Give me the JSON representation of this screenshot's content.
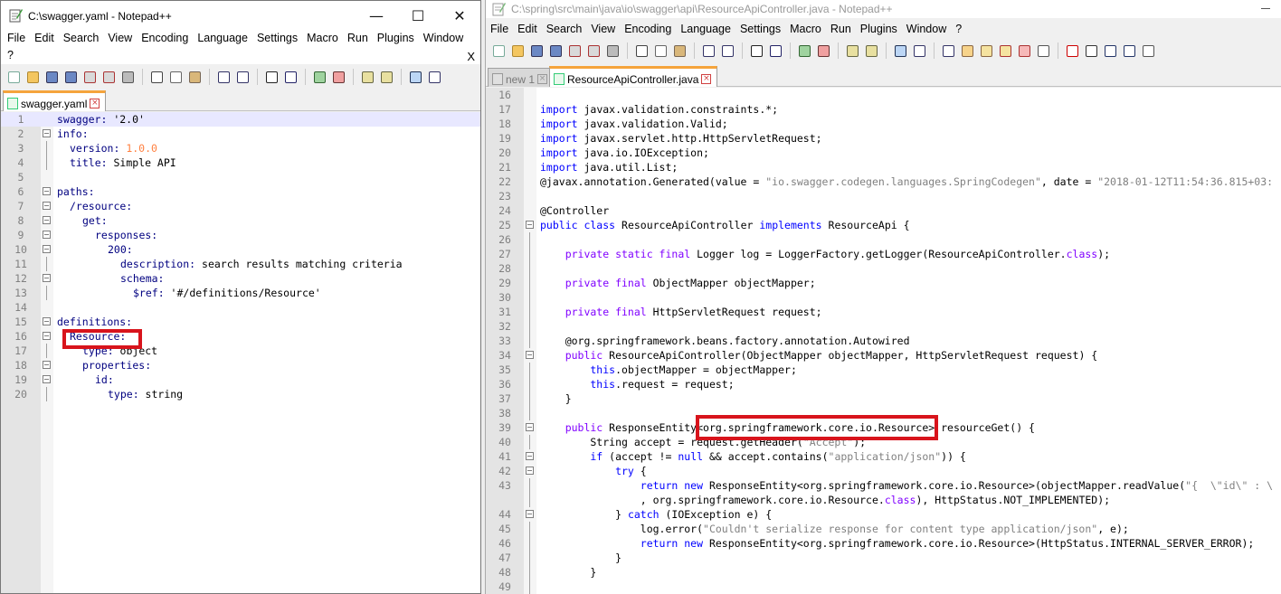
{
  "left_window": {
    "title": "C:\\swagger.yaml - Notepad++",
    "caption": {
      "minimize": "—",
      "maximize": "☐",
      "close": "✕"
    },
    "menu": [
      "File",
      "Edit",
      "Search",
      "View",
      "Encoding",
      "Language",
      "Settings",
      "Macro",
      "Run",
      "Plugins",
      "Window",
      "?"
    ],
    "menu_close": "X",
    "tab": {
      "label": "swagger.yaml",
      "close": "×"
    },
    "lines": [
      {
        "n": "1",
        "fold": "none",
        "indent": 0,
        "segments": [
          {
            "t": "swagger: ",
            "c": "tk-key"
          },
          {
            "t": "'2.0'",
            "c": "tk-str"
          }
        ]
      },
      {
        "n": "2",
        "fold": "box",
        "indent": 0,
        "segments": [
          {
            "t": "info:",
            "c": "tk-key"
          }
        ]
      },
      {
        "n": "3",
        "fold": "line",
        "indent": 2,
        "segments": [
          {
            "t": "version: ",
            "c": "tk-key"
          },
          {
            "t": "1.0.0",
            "c": "tk-num"
          }
        ]
      },
      {
        "n": "4",
        "fold": "line",
        "indent": 2,
        "segments": [
          {
            "t": "title: ",
            "c": "tk-key"
          },
          {
            "t": "Simple API",
            "c": "tk-str"
          }
        ]
      },
      {
        "n": "5",
        "fold": "none",
        "indent": 0,
        "segments": []
      },
      {
        "n": "6",
        "fold": "box",
        "indent": 0,
        "segments": [
          {
            "t": "paths:",
            "c": "tk-key"
          }
        ]
      },
      {
        "n": "7",
        "fold": "box",
        "indent": 2,
        "segments": [
          {
            "t": "/resource:",
            "c": "tk-key"
          }
        ]
      },
      {
        "n": "8",
        "fold": "box",
        "indent": 4,
        "segments": [
          {
            "t": "get:",
            "c": "tk-key"
          }
        ]
      },
      {
        "n": "9",
        "fold": "box",
        "indent": 6,
        "segments": [
          {
            "t": "responses:",
            "c": "tk-key"
          }
        ]
      },
      {
        "n": "10",
        "fold": "box",
        "indent": 8,
        "segments": [
          {
            "t": "200:",
            "c": "tk-key"
          }
        ]
      },
      {
        "n": "11",
        "fold": "line",
        "indent": 10,
        "segments": [
          {
            "t": "description: ",
            "c": "tk-key"
          },
          {
            "t": "search results matching criteria",
            "c": "tk-str"
          }
        ]
      },
      {
        "n": "12",
        "fold": "box",
        "indent": 10,
        "segments": [
          {
            "t": "schema:",
            "c": "tk-key"
          }
        ]
      },
      {
        "n": "13",
        "fold": "line",
        "indent": 12,
        "segments": [
          {
            "t": "$ref: ",
            "c": "tk-key"
          },
          {
            "t": "'#/definitions/Resource'",
            "c": "tk-str"
          }
        ]
      },
      {
        "n": "14",
        "fold": "none",
        "indent": 0,
        "segments": []
      },
      {
        "n": "15",
        "fold": "box",
        "indent": 0,
        "segments": [
          {
            "t": "definitions:",
            "c": "tk-key"
          }
        ]
      },
      {
        "n": "16",
        "fold": "box",
        "indent": 2,
        "segments": [
          {
            "t": "Resource:",
            "c": "tk-key"
          }
        ]
      },
      {
        "n": "17",
        "fold": "line",
        "indent": 4,
        "segments": [
          {
            "t": "type: ",
            "c": "tk-key"
          },
          {
            "t": "object",
            "c": "tk-str"
          }
        ]
      },
      {
        "n": "18",
        "fold": "box",
        "indent": 4,
        "segments": [
          {
            "t": "properties:",
            "c": "tk-key"
          }
        ]
      },
      {
        "n": "19",
        "fold": "box",
        "indent": 6,
        "segments": [
          {
            "t": "id:",
            "c": "tk-key"
          }
        ]
      },
      {
        "n": "20",
        "fold": "line",
        "indent": 8,
        "segments": [
          {
            "t": "type: ",
            "c": "tk-key"
          },
          {
            "t": "string",
            "c": "tk-str"
          }
        ]
      }
    ]
  },
  "right_window": {
    "title": "C:\\spring\\src\\main\\java\\io\\swagger\\api\\ResourceApiController.java - Notepad++",
    "menu": [
      "File",
      "Edit",
      "Search",
      "View",
      "Encoding",
      "Language",
      "Settings",
      "Macro",
      "Run",
      "Plugins",
      "Window",
      "?"
    ],
    "tabs": [
      {
        "label": "new 1",
        "close": "×",
        "active": false
      },
      {
        "label": "ResourceApiController.java",
        "close": "×",
        "active": true
      }
    ],
    "lines": [
      {
        "n": "16",
        "fold": "none",
        "segments": []
      },
      {
        "n": "17",
        "fold": "none",
        "segments": [
          {
            "t": "import ",
            "c": "tk-kw"
          },
          {
            "t": "javax.validation.constraints.*;",
            "c": "tk-ann"
          }
        ]
      },
      {
        "n": "18",
        "fold": "none",
        "segments": [
          {
            "t": "import ",
            "c": "tk-kw"
          },
          {
            "t": "javax.validation.Valid;",
            "c": "tk-ann"
          }
        ]
      },
      {
        "n": "19",
        "fold": "none",
        "segments": [
          {
            "t": "import ",
            "c": "tk-kw"
          },
          {
            "t": "javax.servlet.http.HttpServletRequest;",
            "c": "tk-ann"
          }
        ]
      },
      {
        "n": "20",
        "fold": "none",
        "segments": [
          {
            "t": "import ",
            "c": "tk-kw"
          },
          {
            "t": "java.io.IOException;",
            "c": "tk-ann"
          }
        ]
      },
      {
        "n": "21",
        "fold": "none",
        "segments": [
          {
            "t": "import ",
            "c": "tk-kw"
          },
          {
            "t": "java.util.List;",
            "c": "tk-ann"
          }
        ]
      },
      {
        "n": "22",
        "fold": "none",
        "segments": [
          {
            "t": "@javax.annotation.Generated(value = ",
            "c": "tk-ann"
          },
          {
            "t": "\"io.swagger.codegen.languages.SpringCodegen\"",
            "c": "tk-lit"
          },
          {
            "t": ", date = ",
            "c": "tk-ann"
          },
          {
            "t": "\"2018-01-12T11:54:36.815+03:",
            "c": "tk-lit"
          }
        ]
      },
      {
        "n": "23",
        "fold": "none",
        "segments": []
      },
      {
        "n": "24",
        "fold": "none",
        "segments": [
          {
            "t": "@Controller",
            "c": "tk-ann"
          }
        ]
      },
      {
        "n": "25",
        "fold": "box",
        "segments": [
          {
            "t": "public class ",
            "c": "tk-kw"
          },
          {
            "t": "ResourceApiController ",
            "c": "tk-ann"
          },
          {
            "t": "implements ",
            "c": "tk-kw"
          },
          {
            "t": "ResourceApi {",
            "c": "tk-ann"
          }
        ]
      },
      {
        "n": "26",
        "fold": "line",
        "segments": []
      },
      {
        "n": "27",
        "fold": "line",
        "segments": [
          {
            "t": "    private static final ",
            "c": "tk-kwb"
          },
          {
            "t": "Logger log = LoggerFactory.getLogger(ResourceApiController.",
            "c": "tk-ann"
          },
          {
            "t": "class",
            "c": "tk-kwb"
          },
          {
            "t": ");",
            "c": "tk-ann"
          }
        ]
      },
      {
        "n": "28",
        "fold": "line",
        "segments": []
      },
      {
        "n": "29",
        "fold": "line",
        "segments": [
          {
            "t": "    private final ",
            "c": "tk-kwb"
          },
          {
            "t": "ObjectMapper objectMapper;",
            "c": "tk-ann"
          }
        ]
      },
      {
        "n": "30",
        "fold": "line",
        "segments": []
      },
      {
        "n": "31",
        "fold": "line",
        "segments": [
          {
            "t": "    private final ",
            "c": "tk-kwb"
          },
          {
            "t": "HttpServletRequest request;",
            "c": "tk-ann"
          }
        ]
      },
      {
        "n": "32",
        "fold": "line",
        "segments": []
      },
      {
        "n": "33",
        "fold": "line",
        "segments": [
          {
            "t": "    @org.springframework.beans.factory.annotation.Autowired",
            "c": "tk-ann"
          }
        ]
      },
      {
        "n": "34",
        "fold": "box",
        "segments": [
          {
            "t": "    public ",
            "c": "tk-kwb"
          },
          {
            "t": "ResourceApiController(ObjectMapper objectMapper, HttpServletRequest request) {",
            "c": "tk-ann"
          }
        ]
      },
      {
        "n": "35",
        "fold": "line",
        "segments": [
          {
            "t": "        this",
            "c": "tk-kw"
          },
          {
            "t": ".objectMapper = objectMapper;",
            "c": "tk-ann"
          }
        ]
      },
      {
        "n": "36",
        "fold": "line",
        "segments": [
          {
            "t": "        this",
            "c": "tk-kw"
          },
          {
            "t": ".request = request;",
            "c": "tk-ann"
          }
        ]
      },
      {
        "n": "37",
        "fold": "line",
        "segments": [
          {
            "t": "    }",
            "c": "tk-ann"
          }
        ]
      },
      {
        "n": "38",
        "fold": "line",
        "segments": []
      },
      {
        "n": "39",
        "fold": "box",
        "segments": [
          {
            "t": "    public ",
            "c": "tk-kwb"
          },
          {
            "t": "ResponseEntity<org.springframework.core.io.Resource> resourceGet() {",
            "c": "tk-ann"
          }
        ]
      },
      {
        "n": "40",
        "fold": "line",
        "segments": [
          {
            "t": "        String accept = request.getHeader(",
            "c": "tk-ann"
          },
          {
            "t": "\"Accept\"",
            "c": "tk-lit"
          },
          {
            "t": ");",
            "c": "tk-ann"
          }
        ]
      },
      {
        "n": "41",
        "fold": "box",
        "segments": [
          {
            "t": "        if ",
            "c": "tk-kw"
          },
          {
            "t": "(accept != ",
            "c": "tk-ann"
          },
          {
            "t": "null ",
            "c": "tk-kw"
          },
          {
            "t": "&& accept.contains(",
            "c": "tk-ann"
          },
          {
            "t": "\"application/json\"",
            "c": "tk-lit"
          },
          {
            "t": ")) {",
            "c": "tk-ann"
          }
        ]
      },
      {
        "n": "42",
        "fold": "box",
        "segments": [
          {
            "t": "            try ",
            "c": "tk-kw"
          },
          {
            "t": "{",
            "c": "tk-ann"
          }
        ]
      },
      {
        "n": "43",
        "fold": "line",
        "segments": [
          {
            "t": "                return new ",
            "c": "tk-kw"
          },
          {
            "t": "ResponseEntity<org.springframework.core.io.Resource>(objectMapper.readValue(",
            "c": "tk-ann"
          },
          {
            "t": "\"{  \\\"id\\\" : \\",
            "c": "tk-lit"
          }
        ]
      },
      {
        "n": "",
        "fold": "line",
        "segments": [
          {
            "t": "                , org.springframework.core.io.Resource.",
            "c": "tk-ann"
          },
          {
            "t": "class",
            "c": "tk-kwb"
          },
          {
            "t": "), HttpStatus.NOT_IMPLEMENTED);",
            "c": "tk-ann"
          }
        ]
      },
      {
        "n": "44",
        "fold": "box",
        "segments": [
          {
            "t": "            } ",
            "c": "tk-ann"
          },
          {
            "t": "catch ",
            "c": "tk-kw"
          },
          {
            "t": "(IOException e) {",
            "c": "tk-ann"
          }
        ]
      },
      {
        "n": "45",
        "fold": "line",
        "segments": [
          {
            "t": "                log.error(",
            "c": "tk-ann"
          },
          {
            "t": "\"Couldn't serialize response for content type application/json\"",
            "c": "tk-lit"
          },
          {
            "t": ", e);",
            "c": "tk-ann"
          }
        ]
      },
      {
        "n": "46",
        "fold": "line",
        "segments": [
          {
            "t": "                return new ",
            "c": "tk-kw"
          },
          {
            "t": "ResponseEntity<org.springframework.core.io.Resource>(HttpStatus.INTERNAL_SERVER_ERROR);",
            "c": "tk-ann"
          }
        ]
      },
      {
        "n": "47",
        "fold": "line",
        "segments": [
          {
            "t": "            }",
            "c": "tk-ann"
          }
        ]
      },
      {
        "n": "48",
        "fold": "line",
        "segments": [
          {
            "t": "        }",
            "c": "tk-ann"
          }
        ]
      },
      {
        "n": "49",
        "fold": "line",
        "segments": []
      }
    ]
  },
  "colors": {
    "highlight": "#d8141c",
    "keyword": "#0000ff",
    "yaml_key": "#000080",
    "yaml_number": "#ff8040",
    "active_tab_accent": "#f5a43c"
  }
}
